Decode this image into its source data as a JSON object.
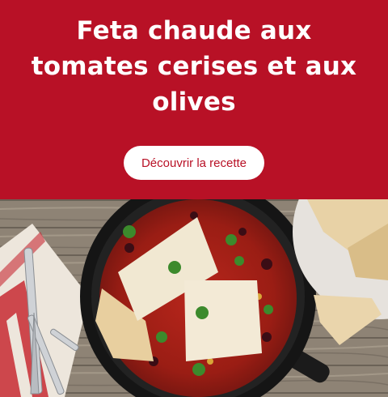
{
  "promo": {
    "title": "Feta chaude aux tomates cerises et aux olives",
    "button_label": "Découvrir la recette",
    "colors": {
      "banner_background": "#b81126",
      "title_text": "#ffffff",
      "button_background": "#ffffff",
      "button_text": "#b81126"
    }
  }
}
